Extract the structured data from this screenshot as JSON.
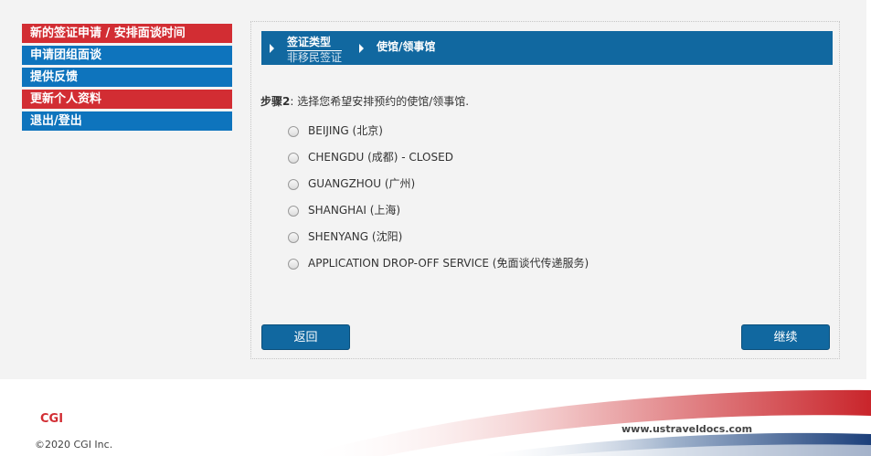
{
  "sidebar": {
    "items": [
      {
        "label": "新的签证申请 / 安排面谈时间",
        "color": "#d22d33"
      },
      {
        "label": "申请团组面谈",
        "color": "#0e74bd"
      },
      {
        "label": "提供反馈",
        "color": "#0e74bd"
      },
      {
        "label": "更新个人资料",
        "color": "#d22d33"
      },
      {
        "label": "退出/登出",
        "color": "#0e74bd"
      }
    ]
  },
  "breadcrumb": {
    "step1_title": "签证类型",
    "step1_value": "非移民签证",
    "step2_title": "使馆/领事馆"
  },
  "step": {
    "label": "步骤2",
    "text": ": 选择您希望安排预约的使馆/领事馆."
  },
  "options": [
    {
      "label": "BEIJING (北京)",
      "selected": false
    },
    {
      "label": "CHENGDU (成都) - CLOSED",
      "selected": false
    },
    {
      "label": "GUANGZHOU (广州)",
      "selected": false
    },
    {
      "label": "SHANGHAI (上海)",
      "selected": false
    },
    {
      "label": "SHENYANG (沈阳)",
      "selected": false
    },
    {
      "label": "APPLICATION DROP-OFF SERVICE (免面谈代传递服务)",
      "selected": false
    }
  ],
  "buttons": {
    "back": "返回",
    "continue": "继续"
  },
  "footer": {
    "logo": "CGI",
    "copyright": "©2020 CGI Inc.",
    "site": "www.ustraveldocs.com"
  },
  "colors": {
    "red": "#d22d33",
    "blue": "#0e74bd",
    "breadcrumb_blue": "#1168a0"
  }
}
